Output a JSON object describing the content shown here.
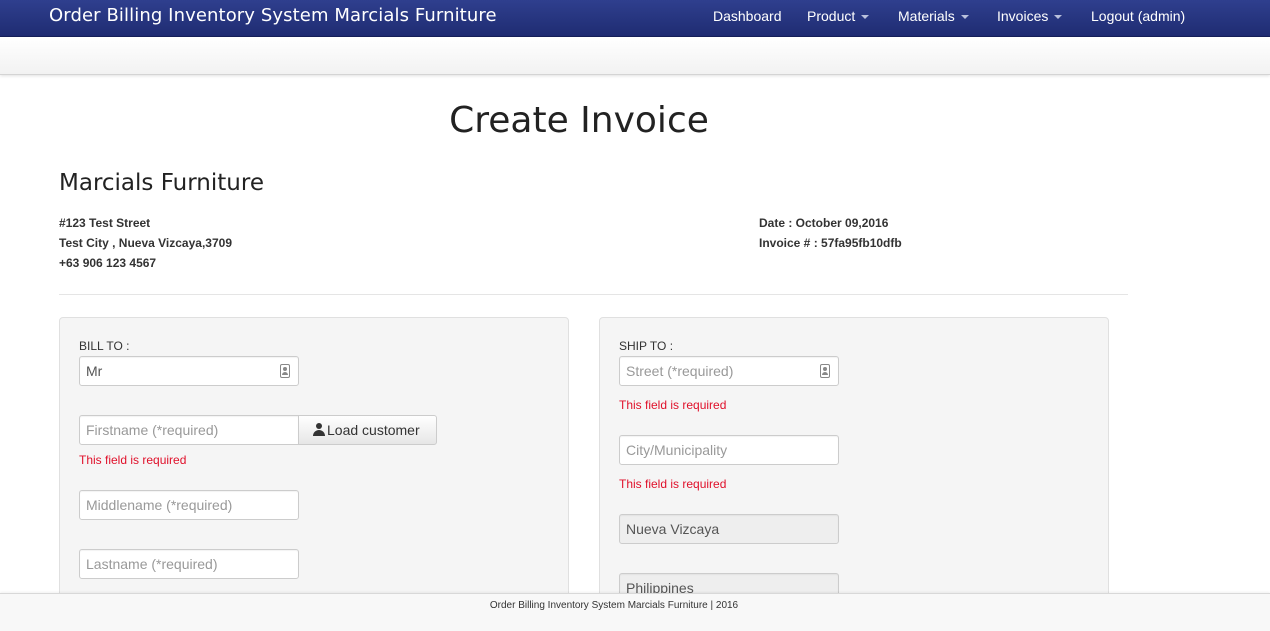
{
  "navbar": {
    "brand": "Order Billing Inventory System Marcials Furniture",
    "items": [
      {
        "label": "Dashboard",
        "dropdown": false
      },
      {
        "label": "Product",
        "dropdown": true
      },
      {
        "label": "Materials",
        "dropdown": true
      },
      {
        "label": "Invoices",
        "dropdown": true
      },
      {
        "label": "Logout (admin)",
        "dropdown": false
      }
    ]
  },
  "page": {
    "title": "Create Invoice"
  },
  "company": {
    "name": "Marcials Furniture",
    "street": "#123 Test Street",
    "city": "Test City , Nueva Vizcaya,3709",
    "phone": "+63 906 123 4567"
  },
  "invoice": {
    "date": "Date : October 09,2016",
    "number": "Invoice # : 57fa95fb10dfb"
  },
  "bill_to": {
    "label": "BILL TO :",
    "title_value": "Mr",
    "firstname_placeholder": "Firstname (*required)",
    "firstname_error": "This field is required",
    "load_customer_label": "Load customer",
    "middlename_placeholder": "Middlename (*required)",
    "lastname_placeholder": "Lastname (*required)"
  },
  "ship_to": {
    "label": "SHIP TO :",
    "street_placeholder": "Street (*required)",
    "street_error": "This field is required",
    "city_placeholder": "City/Municipality",
    "city_error": "This field is required",
    "province_value": "Nueva Vizcaya",
    "country_value": "Philippines"
  },
  "footer": {
    "text": "Order Billing Inventory System Marcials Furniture | 2016"
  },
  "colors": {
    "navbar": "#24327d",
    "error": "#e0102a",
    "panel": "#f5f5f5"
  },
  "icons": {
    "contact_card": "contact-card-icon",
    "user": "user-icon",
    "caret": "caret-down-icon"
  }
}
